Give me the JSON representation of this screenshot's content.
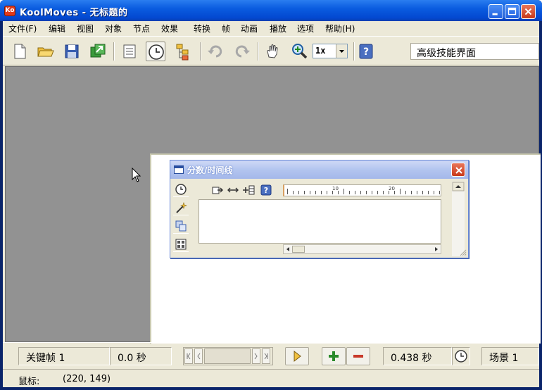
{
  "window": {
    "title": "KoolMoves - 无标题的",
    "app_icon_text": "Ko"
  },
  "menu": {
    "items": [
      "文件(F)",
      "编辑",
      "视图",
      "对象",
      "节点",
      "效果",
      "转换",
      "帧",
      "动画",
      "播放",
      "选项",
      "帮助(H)"
    ]
  },
  "toolbar": {
    "zoom_value": "1x",
    "interface_mode": "高级技能界面",
    "icons": [
      "new-file-icon",
      "open-folder-icon",
      "save-disk-icon",
      "export-icon",
      "list-icon",
      "clock-icon",
      "tree-icon",
      "undo-icon",
      "redo-icon",
      "hand-icon",
      "zoom-magnifier-icon",
      "help-icon"
    ]
  },
  "timeline": {
    "title": "分数/时间线",
    "ruler_labels": [
      "10",
      "20"
    ]
  },
  "status": {
    "keyframe_label": "关键帧 1",
    "time_value": "0.0 秒",
    "duration_value": "0.438 秒",
    "scene_label": "场景 1",
    "mouse_label": "鼠标:",
    "mouse_coords": "(220, 149)"
  },
  "colors": {
    "titlebar": "#0a5ce0",
    "stage_bg": "#929292",
    "chrome": "#ece9d8"
  }
}
